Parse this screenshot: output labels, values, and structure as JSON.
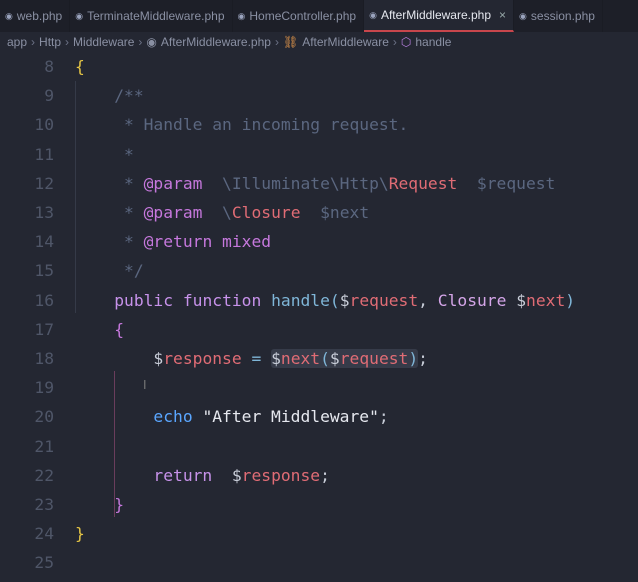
{
  "tabs": [
    {
      "label": "web.php",
      "active": false
    },
    {
      "label": "TerminateMiddleware.php",
      "active": false
    },
    {
      "label": "HomeController.php",
      "active": false
    },
    {
      "label": "AfterMiddleware.php",
      "active": true
    },
    {
      "label": "session.php",
      "active": false
    }
  ],
  "breadcrumb": [
    "app",
    "Http",
    "Middleware",
    "AfterMiddleware.php",
    "AfterMiddleware",
    "handle"
  ],
  "close_glyph": "×",
  "lines": [
    {
      "n": "8",
      "t": [
        [
          "{",
          "brace"
        ]
      ]
    },
    {
      "n": "9",
      "t": [
        [
          "    /**",
          "com"
        ]
      ]
    },
    {
      "n": "10",
      "t": [
        [
          "     * Handle an incoming request.",
          "com"
        ]
      ]
    },
    {
      "n": "11",
      "t": [
        [
          "     *",
          "com"
        ]
      ]
    },
    {
      "n": "12",
      "t": [
        [
          "     * ",
          "com"
        ],
        [
          "@param",
          "tag"
        ],
        [
          "  \\Illuminate\\Http\\",
          "com"
        ],
        [
          "Request",
          "cls"
        ],
        [
          "  $request",
          "com"
        ]
      ]
    },
    {
      "n": "13",
      "t": [
        [
          "     * ",
          "com"
        ],
        [
          "@param",
          "tag"
        ],
        [
          "  \\",
          "com"
        ],
        [
          "Closure",
          "cls"
        ],
        [
          "  $next",
          "com"
        ]
      ]
    },
    {
      "n": "14",
      "t": [
        [
          "     * ",
          "com"
        ],
        [
          "@return",
          "tag"
        ],
        [
          " mixed",
          "tag"
        ]
      ]
    },
    {
      "n": "15",
      "t": [
        [
          "     */",
          "com"
        ]
      ]
    },
    {
      "n": "16",
      "t": [
        [
          "    ",
          "pun"
        ],
        [
          "public",
          "kw"
        ],
        [
          " ",
          "pun"
        ],
        [
          "function",
          "kw"
        ],
        [
          " ",
          "pun"
        ],
        [
          "handle",
          "fn"
        ],
        [
          "(",
          "par"
        ],
        [
          "$",
          "dol"
        ],
        [
          "request",
          "var"
        ],
        [
          ", ",
          "pun"
        ],
        [
          "Closure",
          "clo"
        ],
        [
          " ",
          "pun"
        ],
        [
          "$",
          "dol"
        ],
        [
          "next",
          "var"
        ],
        [
          ")",
          "par"
        ]
      ]
    },
    {
      "n": "17",
      "t": [
        [
          "    {",
          "brace2"
        ]
      ]
    },
    {
      "n": "18",
      "t": [
        [
          "        ",
          "pun"
        ],
        [
          "$",
          "dol"
        ],
        [
          "response",
          "var"
        ],
        [
          " = ",
          "fn"
        ],
        [
          "$",
          "dol"
        ],
        [
          "next",
          "var"
        ],
        [
          "(",
          "par"
        ],
        [
          "$",
          "dol"
        ],
        [
          "request",
          "var"
        ],
        [
          ")",
          "par"
        ],
        [
          ";",
          "pun"
        ]
      ]
    },
    {
      "n": "19",
      "t": []
    },
    {
      "n": "20",
      "t": [
        [
          "        ",
          "pun"
        ],
        [
          "echo",
          "echo"
        ],
        [
          " \"After Middleware\"",
          "str"
        ],
        [
          ";",
          "pun"
        ]
      ]
    },
    {
      "n": "21",
      "t": []
    },
    {
      "n": "22",
      "t": [
        [
          "        ",
          "pun"
        ],
        [
          "return",
          "kw"
        ],
        [
          "  ",
          "pun"
        ],
        [
          "$",
          "dol"
        ],
        [
          "response",
          "var"
        ],
        [
          ";",
          "pun"
        ]
      ]
    },
    {
      "n": "23",
      "t": [
        [
          "    }",
          "brace2"
        ]
      ]
    },
    {
      "n": "24",
      "t": [
        [
          "}",
          "brace"
        ]
      ]
    },
    {
      "n": "25",
      "t": []
    }
  ]
}
